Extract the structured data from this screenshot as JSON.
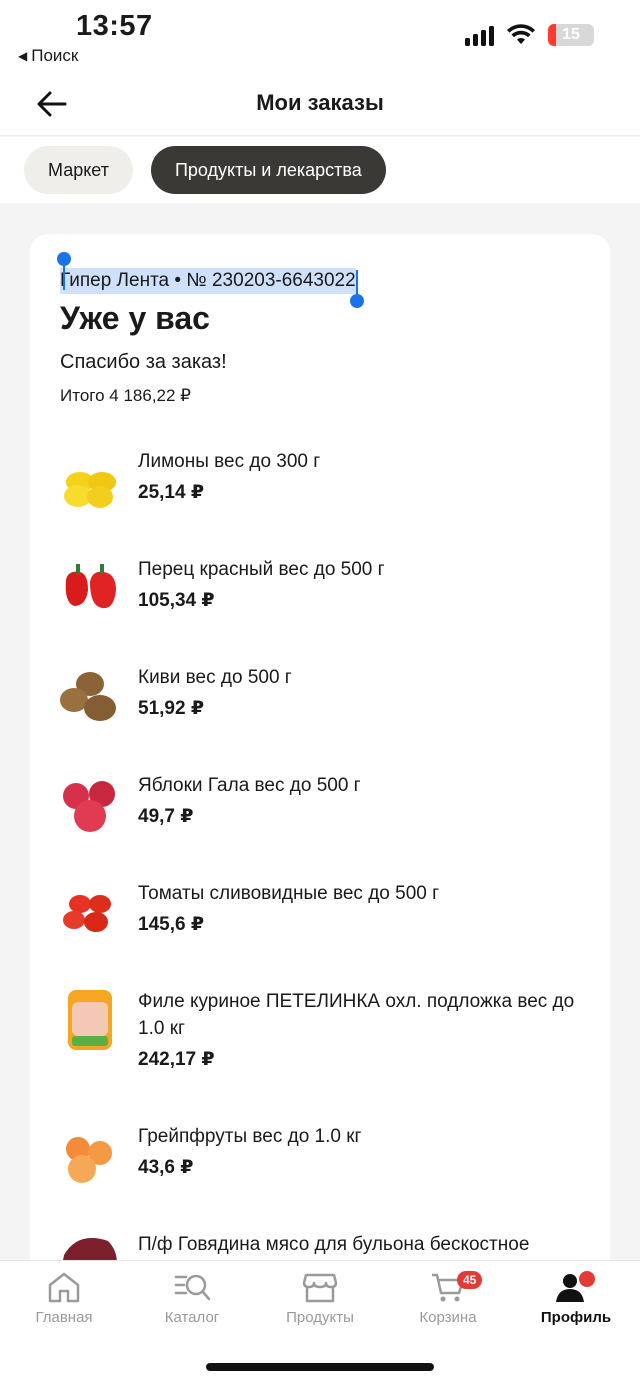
{
  "status_bar": {
    "time": "13:57",
    "back_app": "Поиск",
    "battery": "15"
  },
  "header": {
    "title": "Мои заказы"
  },
  "tabs": [
    {
      "label": "Маркет",
      "active": false
    },
    {
      "label": "Продукты и лекарства",
      "active": true
    }
  ],
  "order": {
    "store_and_id": "Гипер Лента • № 230203-6643022",
    "status": "Уже у вас",
    "thanks": "Спасибо за заказ!",
    "total": "Итого 4 186,22 ₽"
  },
  "items": [
    {
      "name": "Лимоны  вес до 300 г",
      "price": "25,14 ₽",
      "icon": "lemon"
    },
    {
      "name": "Перец  красный вес до 500 г",
      "price": "105,34 ₽",
      "icon": "pepper"
    },
    {
      "name": "Киви  вес до 500 г",
      "price": "51,92 ₽",
      "icon": "kiwi"
    },
    {
      "name": "Яблоки  Гала вес до 500 г",
      "price": "49,7 ₽",
      "icon": "apple"
    },
    {
      "name": "Томаты  сливовидные вес до 500 г",
      "price": "145,6 ₽",
      "icon": "tomato"
    },
    {
      "name": "Филе куриное ПЕТЕЛИНКА охл. подложка вес до 1.0 кг",
      "price": "242,17 ₽",
      "icon": "chicken"
    },
    {
      "name": "Грейпфруты  вес до 1.0 кг",
      "price": "43,6 ₽",
      "icon": "grapefruit"
    },
    {
      "name": "П/ф Говядина мясо для бульона бескостное",
      "price": "",
      "icon": "beef"
    }
  ],
  "tabbar": {
    "home": "Главная",
    "catalog": "Каталог",
    "products": "Продукты",
    "cart": "Корзина",
    "cart_badge": "45",
    "profile": "Профиль"
  },
  "colors": {
    "accent": "#3a3936",
    "selection": "#cfe0fb",
    "handle": "#1a73e8",
    "badge": "#e53935"
  }
}
